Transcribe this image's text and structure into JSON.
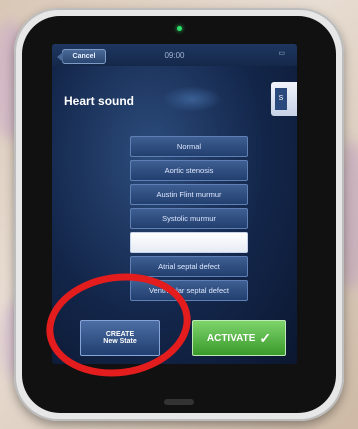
{
  "status_bar": {
    "cancel_label": "Cancel",
    "time": "09:00"
  },
  "header": {
    "title": "Heart sound",
    "side_tab_text": "S"
  },
  "sound_list": [
    {
      "label": "Normal",
      "selected": false
    },
    {
      "label": "Aortic stenosis",
      "selected": false
    },
    {
      "label": "Austin Flint murmur",
      "selected": false
    },
    {
      "label": "Systolic murmur",
      "selected": false
    },
    {
      "label": "",
      "selected": true
    },
    {
      "label": "Atrial septal defect",
      "selected": false
    },
    {
      "label": "Ventricular septal defect",
      "selected": false
    }
  ],
  "actions": {
    "create_line1": "CREATE",
    "create_line2": "New State",
    "activate_label": "ACTIVATE"
  },
  "colors": {
    "accent_green": "#3a9a2b",
    "annotation_red": "#e31d1d",
    "screen_blue": "#13264a"
  }
}
